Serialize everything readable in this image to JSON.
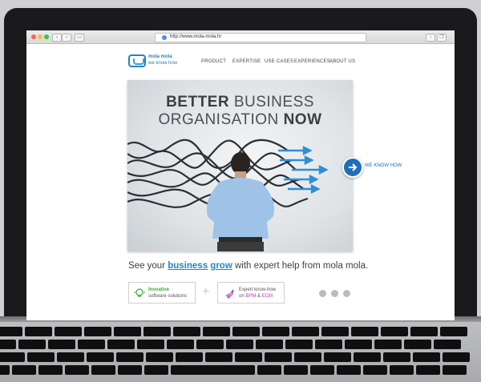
{
  "browser": {
    "url": "http://www.mola-mola.hr"
  },
  "site": {
    "logo_line1": "mola mola",
    "logo_line2": "we know how",
    "nav": [
      "PRODUCT",
      "EXPERTISE",
      "USE CASES",
      "EXPERIENCES",
      "ABOUT US"
    ]
  },
  "hero": {
    "line1_bold": "BETTER",
    "line1_rest": " BUSINESS",
    "line2_rest": "ORGANISATION ",
    "line2_bold": "NOW",
    "knowhow_label": "WE KNOW HOW"
  },
  "tagline": {
    "prefix": "See your ",
    "link1": "business",
    "space": " ",
    "link2": "grow",
    "suffix": " with expert help from mola mola."
  },
  "features": {
    "card1_line1": "Inovative",
    "card1_line2": "software solutions",
    "plus": "+",
    "card2_line1": "Expert know-how",
    "card2_line2_prefix": "on ",
    "card2_line2_bpm": "BPM",
    "card2_line2_amp": " & ",
    "card2_line2_ecm": "ECM"
  },
  "colors": {
    "brand_blue": "#1f6fb6",
    "link_blue": "#1f86c8",
    "green": "#3fa535",
    "magenta": "#b53aa8"
  },
  "icons": {
    "nav_back": "chevron-left-icon",
    "nav_forward": "chevron-right-icon",
    "sidebar": "sidebar-icon",
    "share": "share-icon",
    "tabs": "tabs-icon",
    "arrow": "arrow-right-icon"
  }
}
